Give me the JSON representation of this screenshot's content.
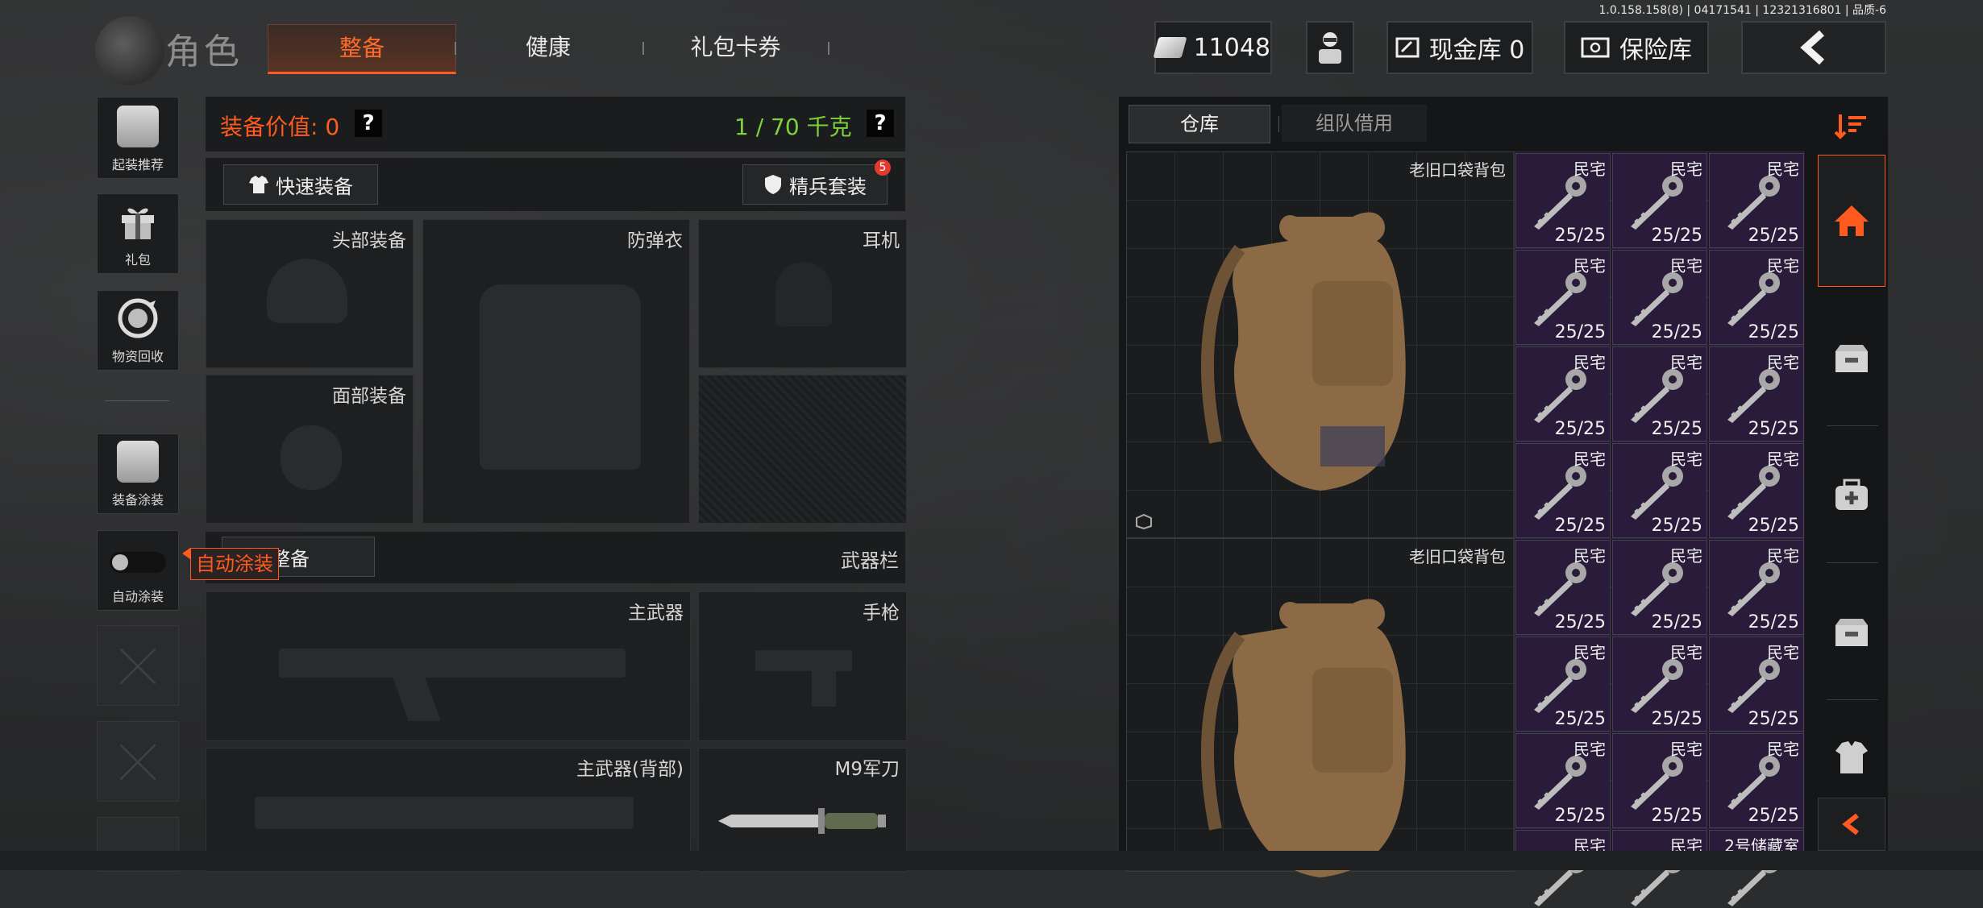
{
  "version": "1.0.158.158(8) | 04171541 | 12321316801 | 品质-6",
  "header": {
    "title": "角色",
    "tabs": [
      {
        "label": "整备",
        "active": true
      },
      {
        "label": "健康",
        "active": false
      },
      {
        "label": "礼包卡券",
        "active": false
      }
    ],
    "currency": "11048",
    "cash_vault": "现金库 0",
    "safe": "保险库"
  },
  "left_column": {
    "items": [
      {
        "label": "起装推荐",
        "icon": "helmet-gun-icon"
      },
      {
        "label": "礼包",
        "icon": "gift-icon"
      },
      {
        "label": "物资回收",
        "icon": "recycle-icon"
      },
      {
        "label": "装备涂装",
        "icon": "paint-gear-icon"
      },
      {
        "label": "自动涂装",
        "icon": "toggle-icon"
      }
    ],
    "tooltip": "自动涂装"
  },
  "equipment": {
    "value_label": "装备价值: 0",
    "weight_label": "1 / 70 千克",
    "quick_equip": "快速装备",
    "elite_set": "精兵套装",
    "elite_badge": "5",
    "ammo_prep": "弹药整备",
    "weapon_bar": "武器栏",
    "slots": {
      "head": "头部装备",
      "armor": "防弹衣",
      "earphone": "耳机",
      "face": "面部装备",
      "primary": "主武器",
      "pistol": "手枪",
      "primary_back": "主武器(背部)",
      "knife": "M9军刀"
    }
  },
  "warehouse": {
    "tabs": [
      {
        "label": "仓库",
        "active": true
      },
      {
        "label": "组队借用",
        "active": false
      }
    ],
    "bags": [
      {
        "name": "老旧口袋背包"
      },
      {
        "name": "老旧口袋背包"
      }
    ],
    "key_title": "民宅",
    "key_count": "25/25",
    "last_key_title": "2号储藏室",
    "colors": {
      "key_bg": "#2a1b3a",
      "accent": "#ff5a1f",
      "weight_ok": "#7dd13b"
    }
  },
  "right_rail": {
    "icons": [
      "sort-icon",
      "home-icon",
      "storage-box-icon",
      "medkit-icon",
      "storage-box-2-icon",
      "vest-icon",
      "collapse-arrow-icon"
    ]
  }
}
